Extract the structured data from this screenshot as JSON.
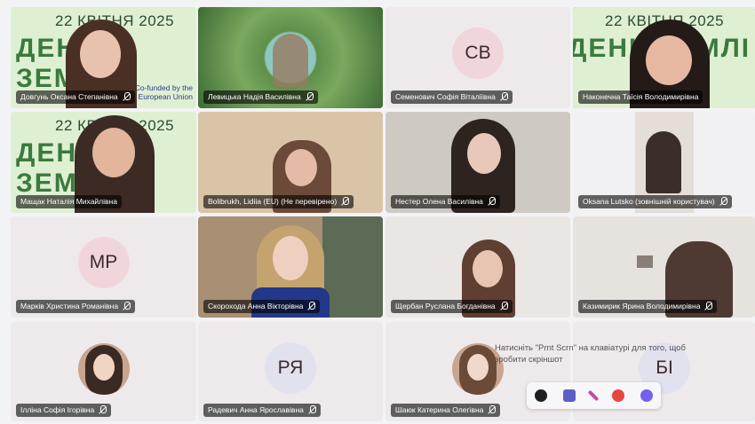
{
  "banner": {
    "date": "22 КВІТНЯ 2025",
    "title": "ДЕНЬ ЗЕМЛІ",
    "cofund_line1": "Co-funded by the",
    "cofund_line2": "European Union"
  },
  "participants": [
    {
      "name": "Довгунь Оксана Степанівна"
    },
    {
      "name": "Левицька Надія Василівна"
    },
    {
      "name": "Семенович Софія Віталіївна",
      "initials": "СВ"
    },
    {
      "name": "Наконечна Таїсія Володимирівна"
    },
    {
      "name": "Мащак Наталія Михайлівна"
    },
    {
      "name": "Bolibrukh, Lidiia (EU) (Не перевірено)"
    },
    {
      "name": "Нестер Олена Василівна"
    },
    {
      "name": "Oksana Lutsko (зовнішній користувач)"
    },
    {
      "name": "Марків Христина Романівна",
      "initials": "МР"
    },
    {
      "name": "Скорохода Анна Вікторівна"
    },
    {
      "name": "Щербан Руслана Богданівна"
    },
    {
      "name": "Казимирик Ярина Володимирівна"
    },
    {
      "name": "Ілліна Софія Ігорівна"
    },
    {
      "name": "Радевич Анна Ярославівна",
      "initials": "РЯ"
    },
    {
      "name": "Шаюк Катерина Олегівна"
    },
    {
      "name": "",
      "initials": "БІ"
    }
  ],
  "tooltip": "Натисніть \"Prnt Scrn\" на клавіатурі для того, щоб зробити скріншот",
  "tray_icons": [
    "grammarly-icon",
    "teams-icon",
    "pen-icon",
    "chrome-icon",
    "viber-icon"
  ]
}
